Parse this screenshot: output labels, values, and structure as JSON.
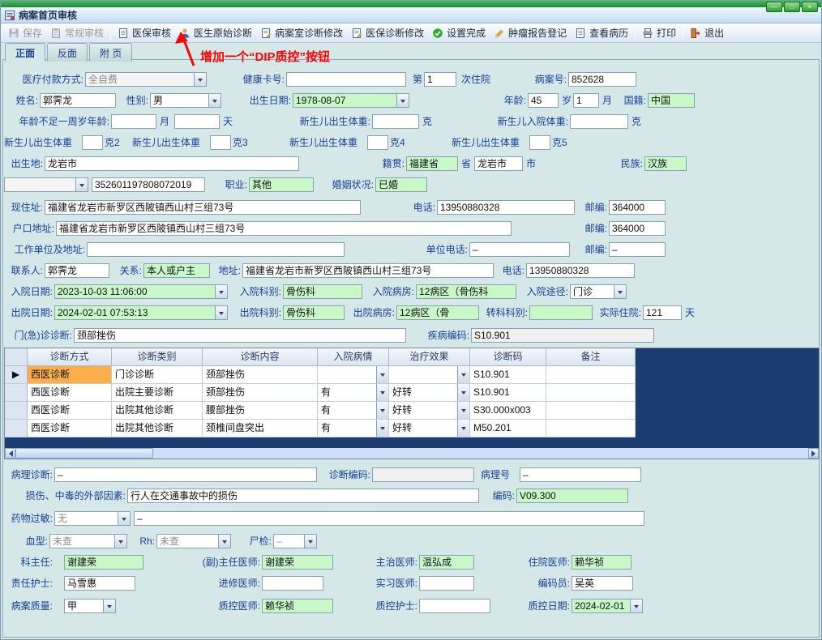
{
  "window": {
    "title": "病案首页审核",
    "controls": {
      "minimize": "—",
      "restore": "□",
      "close": "×"
    }
  },
  "toolbar": {
    "save": "保存",
    "regular_audit": "常规审核",
    "insurance_audit": "医保审核",
    "doctor_original_dx": "医生原始诊断",
    "record_room_dx_edit": "病案室诊断修改",
    "insurance_dx_edit": "医保诊断修改",
    "setup_complete": "设置完成",
    "tumor_report": "肿瘤报告登记",
    "view_record": "查看病历",
    "print": "打印",
    "exit": "退出"
  },
  "annotation": {
    "text": "增加一个“DIP质控”按钮"
  },
  "tabs": {
    "front": "正面",
    "back": "反面",
    "appendix": "附 页"
  },
  "form": {
    "payment_label": "医疗付款方式:",
    "payment": "全自费",
    "health_card_label": "健康卡号:",
    "health_card": "",
    "visit_prefix": "第",
    "visit_no": "1",
    "visit_suffix": "次住院",
    "record_no_label": "病案号:",
    "record_no": "852628",
    "name_label": "姓名:",
    "name": "郭霁龙",
    "gender_label": "性别:",
    "gender": "男",
    "birth_date_label": "出生日期:",
    "birth_date": "1978-08-07",
    "age_label": "年龄:",
    "age": "45",
    "age_unit": "岁",
    "age_months": "1",
    "month_unit": "月",
    "day_unit": "天",
    "gram_unit": "克",
    "nationality_label": "国籍:",
    "nationality": "中国",
    "infant_age_label": "年龄不足一周岁年龄:",
    "infant_age_months": "",
    "infant_age_days": "",
    "newborn_weight_label": "新生儿出生体重:",
    "newborn_weight": "",
    "newborn_adm_weight_label": "新生儿入院体重:",
    "newborn_adm_weight": "",
    "nb_weight_label": "新生儿出生体重",
    "nb_weight2": "",
    "nb_weight3": "",
    "nb_weight4": "",
    "nb_weight5": "",
    "u_ke2": "克2",
    "u_ke3": "克3",
    "u_ke4": "克4",
    "u_ke5": "克5",
    "birthplace_label": "出生地:",
    "birthplace": "龙岩市",
    "native_place_label": "籍贯:",
    "native_province": "福建省",
    "province_unit": "省",
    "native_city": "龙岩市",
    "city_unit": "市",
    "ethnicity_label": "民族:",
    "ethnicity": "汉族",
    "id_type": "",
    "id_number": "352601197808072019",
    "occupation_label": "职业:",
    "occupation": "其他",
    "marital_label": "婚姻状况:",
    "marital": "已婚",
    "current_addr_label": "现住址:",
    "current_addr": "福建省龙岩市新罗区西陂镇西山村三组73号",
    "phone_label": "电话:",
    "phone": "13950880328",
    "zip_label": "邮编:",
    "zip": "364000",
    "household_addr_label": "户口地址:",
    "household_addr": "福建省龙岩市新罗区西陂镇西山村三组73号",
    "household_zip": "364000",
    "work_unit_label": "工作单位及地址:",
    "work_unit": "",
    "work_phone_label": "单位电话:",
    "work_phone": "–",
    "work_zip": "–",
    "contact_label": "联系人:",
    "contact": "郭霁龙",
    "relation_label": "关系:",
    "relation": "本人或户主",
    "addr_label": "地址:",
    "contact_addr": "福建省龙岩市新罗区西陂镇西山村三组73号",
    "contact_phone": "13950880328",
    "adm_date_label": "入院日期:",
    "adm_date": "2023-10-03 11:06:00",
    "adm_dept_label": "入院科别:",
    "adm_dept": "骨伤科",
    "adm_ward_label": "入院病房:",
    "adm_ward": "12病区（骨伤科",
    "adm_path_label": "入院途径:",
    "adm_path": "门诊",
    "dis_date_label": "出院日期:",
    "dis_date": "2024-02-01 07:53:13",
    "dis_dept_label": "出院科别:",
    "dis_dept": "骨伤科",
    "dis_ward_label": "出院病房:",
    "dis_ward": "12病区（骨",
    "transfer_dept_label": "转科科别:",
    "transfer_dept": "",
    "actual_days_label": "实际住院:",
    "actual_days": "121",
    "outpatient_dx_label": "门(急)诊诊断:",
    "outpatient_dx": "颈部挫伤",
    "disease_code_label": "疾病编码:",
    "disease_code": "S10.901",
    "pathology_dx_label": "病理诊断:",
    "pathology_dx": "–",
    "dx_code_label": "诊断编码:",
    "dx_code": "",
    "pathology_no_label": "病理号",
    "pathology_no": "–",
    "injury_label": "损伤、中毒的外部因素:",
    "injury": "行人在交通事故中的损伤",
    "code_label": "编码:",
    "injury_code": "V09.300",
    "allergy_label": "药物过敏:",
    "allergy": "无",
    "allergy_detail": "–",
    "blood_label": "血型:",
    "blood": "未查",
    "rh_label": "Rh:",
    "rh": "未查",
    "autopsy_label": "尸检:",
    "autopsy": "–",
    "dept_head_label": "科主任:",
    "dept_head": "谢建荣",
    "deputy_chief_label": "(副)主任医师:",
    "deputy_chief": "谢建荣",
    "attending_label": "主治医师:",
    "attending": "温弘成",
    "resident_label": "住院医师:",
    "resident": "赖华祯",
    "nurse_label": "责任护士:",
    "nurse": "马雪惠",
    "trainee_label": "进修医师:",
    "trainee": "",
    "intern_label": "实习医师:",
    "intern": "",
    "coder_label": "编码员:",
    "coder": "吴英",
    "quality_label": "病案质量:",
    "quality": "甲",
    "qc_doctor_label": "质控医师:",
    "qc_doctor": "赖华祯",
    "qc_nurse_label": "质控护士:",
    "qc_nurse": "",
    "qc_date_label": "质控日期:",
    "qc_date": "2024-02-01"
  },
  "table": {
    "marker": "▶",
    "headers": {
      "method": "诊断方式",
      "category": "诊断类别",
      "content": "诊断内容",
      "condition": "入院病情",
      "effect": "治疗效果",
      "code": "诊断码",
      "remark": "备注"
    },
    "rows": [
      {
        "method": "西医诊断",
        "category": "门诊诊断",
        "content": "颈部挫伤",
        "condition": "",
        "effect": "",
        "code": "S10.901",
        "remark": ""
      },
      {
        "method": "西医诊断",
        "category": "出院主要诊断",
        "content": "颈部挫伤",
        "condition": "有",
        "effect": "好转",
        "code": "S10.901",
        "remark": ""
      },
      {
        "method": "西医诊断",
        "category": "出院其他诊断",
        "content": "腰部挫伤",
        "condition": "有",
        "effect": "好转",
        "code": "S30.000x003",
        "remark": ""
      },
      {
        "method": "西医诊断",
        "category": "出院其他诊断",
        "content": "颈椎间盘突出",
        "condition": "有",
        "effect": "好转",
        "code": "M50.201",
        "remark": ""
      }
    ]
  },
  "colors": {
    "green_field": "#c8f7c8",
    "selected_cell": "#fcae4a",
    "grid_dark_bg": "#1c3d72",
    "annotation_red": "#ff0000"
  }
}
